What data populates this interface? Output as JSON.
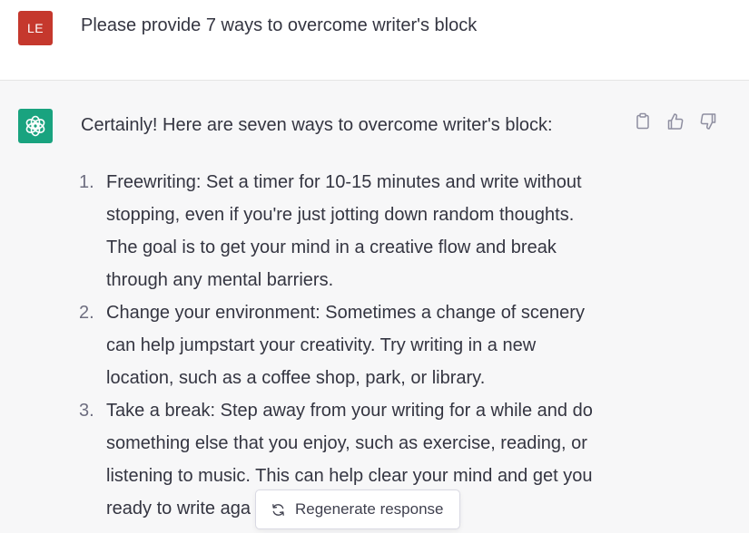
{
  "user": {
    "avatar_initials": "LE",
    "avatar_color": "#c5382d",
    "message": "Please provide 7 ways to overcome writer's block"
  },
  "assistant": {
    "avatar_icon": "openai-logo-icon",
    "avatar_color": "#19a37f",
    "intro": "Certainly! Here are seven ways to overcome writer's block:",
    "actions": [
      {
        "name": "copy-icon"
      },
      {
        "name": "thumbs-up-icon"
      },
      {
        "name": "thumbs-down-icon"
      }
    ],
    "items": [
      {
        "number": "1.",
        "lines": [
          "Freewriting: Set a timer for 10-15 minutes and write without",
          "stopping, even if you're just jotting down random thoughts.",
          "The goal is to get your mind in a creative flow and break",
          "through any mental barriers."
        ]
      },
      {
        "number": "2.",
        "lines": [
          "Change your environment: Sometimes a change of scenery",
          "can help jumpstart your creativity. Try writing in a new",
          "location, such as a coffee shop, park, or library."
        ]
      },
      {
        "number": "3.",
        "lines": [
          "Take a break: Step away from your writing for a while and do",
          "something else that you enjoy, such as exercise, reading, or",
          "listening to music. This can help clear your mind and get you",
          "ready to write aga"
        ]
      }
    ]
  },
  "regenerate": {
    "label": "Regenerate response",
    "icon": "refresh-icon"
  }
}
